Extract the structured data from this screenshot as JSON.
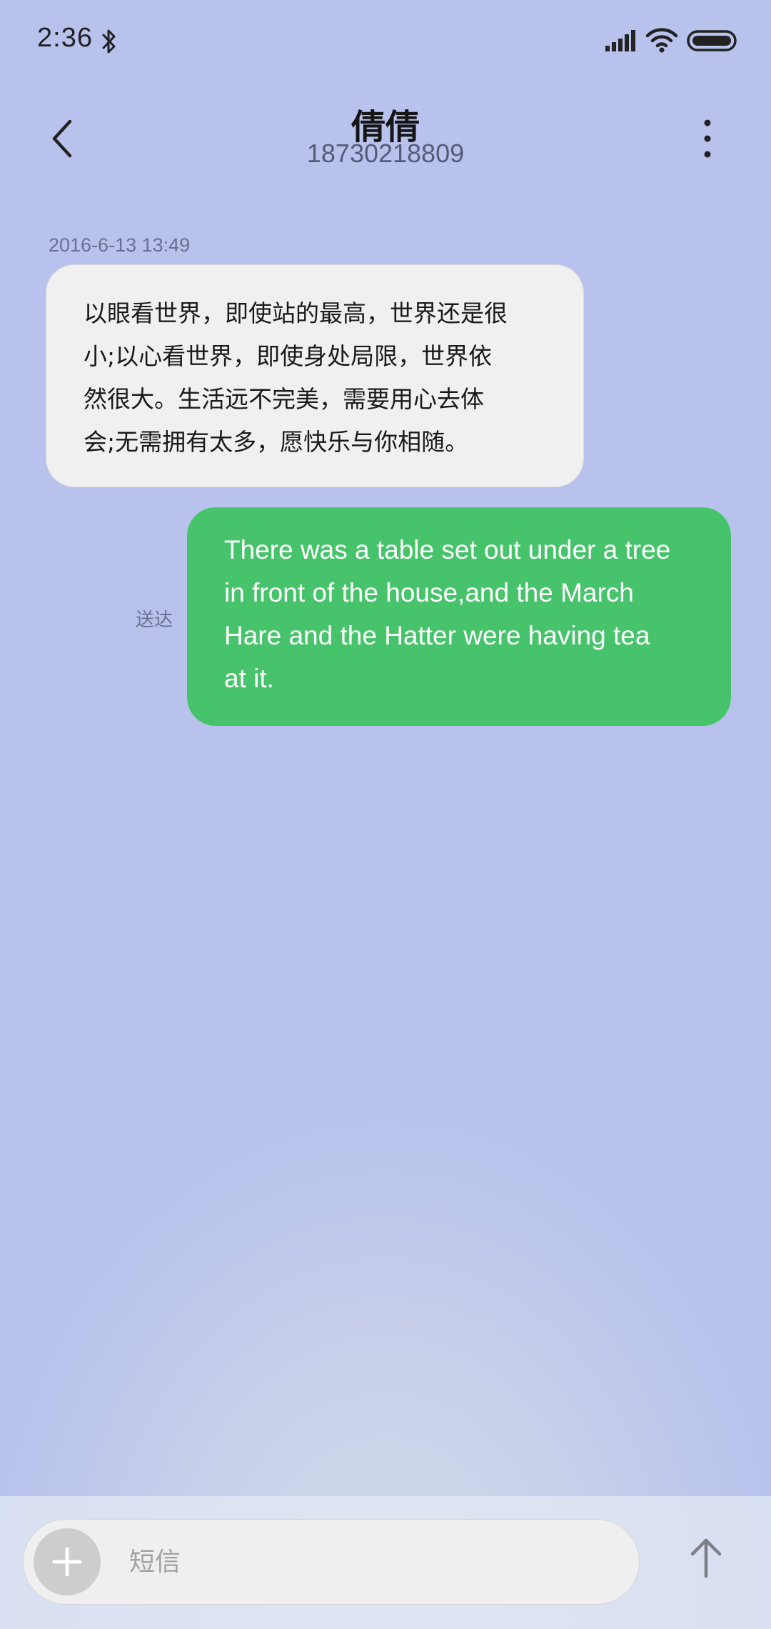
{
  "status_bar": {
    "time": "2:36",
    "icons": [
      "bluetooth-icon",
      "signal-icon",
      "wifi-icon",
      "battery-icon"
    ]
  },
  "header": {
    "back_icon": "back-arrow-icon",
    "contact_name": "倩倩",
    "contact_number": "18730218809",
    "more_icon": "more-vertical-icon"
  },
  "conversation": {
    "timestamp": "2016-6-13 13:49",
    "incoming": {
      "lines": [
        "以眼看世界，即使站的最高，世界还是很",
        "小;以心看世界，即使身处局限，世界依",
        "然很大。生活远不完美，需要用心去体",
        "会;无需拥有太多，愿快乐与你相随。"
      ]
    },
    "outgoing": {
      "lines": [
        "There was a table set out under a tree",
        "in front of the house,and the March",
        "Hare and the Hatter were having tea",
        "at it."
      ],
      "status": "送达"
    }
  },
  "composer": {
    "add_icon": "plus-icon",
    "placeholder": "短信",
    "send_icon": "send-arrow-icon"
  },
  "colors": {
    "background": "#b8c2ed",
    "incoming_bubble": "#f0f0f0",
    "outgoing_bubble": "#47c46b",
    "input_background": "#efefef"
  }
}
